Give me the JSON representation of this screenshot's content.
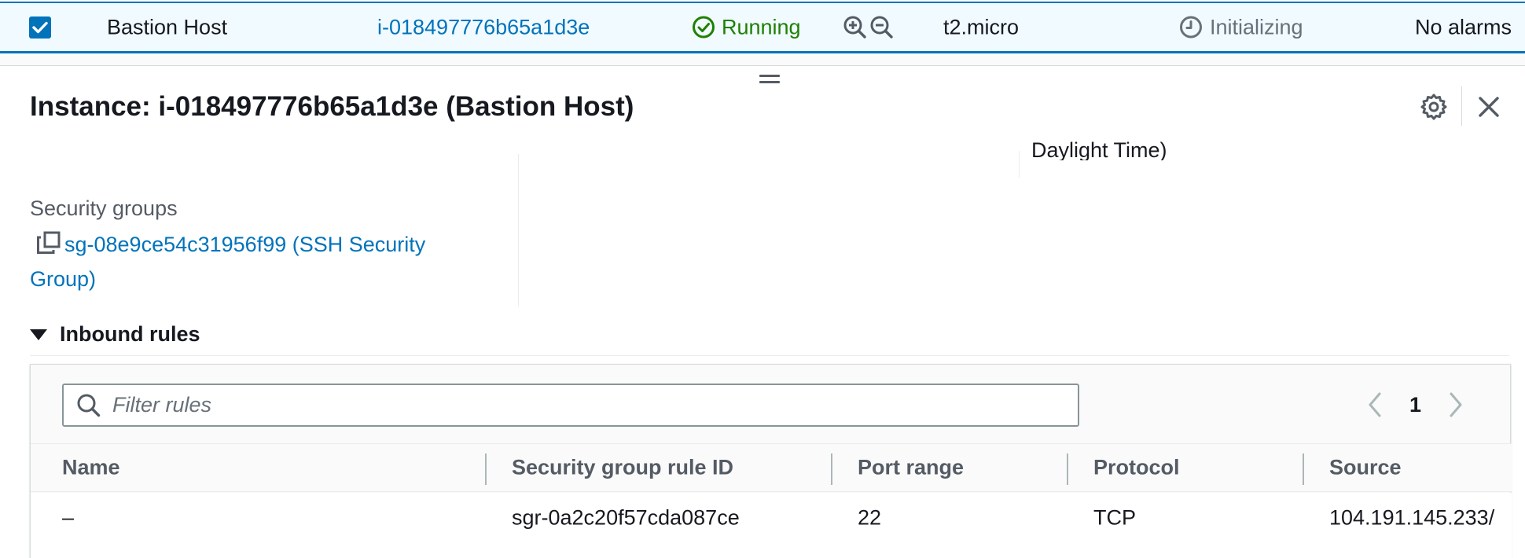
{
  "instance_row": {
    "checked": true,
    "name": "Bastion Host",
    "instance_id": "i-018497776b65a1d3e",
    "state": "Running",
    "instance_type": "t2.micro",
    "status_check": "Initializing",
    "alarm_status": "No alarms"
  },
  "panel": {
    "title": "Instance: i-018497776b65a1d3e (Bastion Host)",
    "clipped_text": "Daylight Time)",
    "security_groups_label": "Security groups",
    "security_group_value": "sg-08e9ce54c31956f99 (SSH Security Group)"
  },
  "inbound_rules": {
    "header": "Inbound rules",
    "filter_placeholder": "Filter rules",
    "current_page": "1",
    "columns": [
      "Name",
      "Security group rule ID",
      "Port range",
      "Protocol",
      "Source"
    ],
    "rows": [
      [
        "–",
        "sgr-0a2c20f57cda087ce",
        "22",
        "TCP",
        "104.191.145.233/"
      ]
    ]
  },
  "colors": {
    "accent_blue": "#0073bb",
    "running_green": "#1d8102",
    "muted_gray": "#687078"
  },
  "icons": {
    "checkbox": "checkbox-checked-icon",
    "state": "check-circle-icon",
    "zoom_in": "zoom-in-icon",
    "zoom_out": "zoom-out-icon",
    "status": "clock-icon",
    "settings": "gear-icon",
    "close": "close-icon",
    "copy": "copy-icon",
    "search": "search-icon",
    "prev": "chevron-left-icon",
    "next": "chevron-right-icon"
  }
}
